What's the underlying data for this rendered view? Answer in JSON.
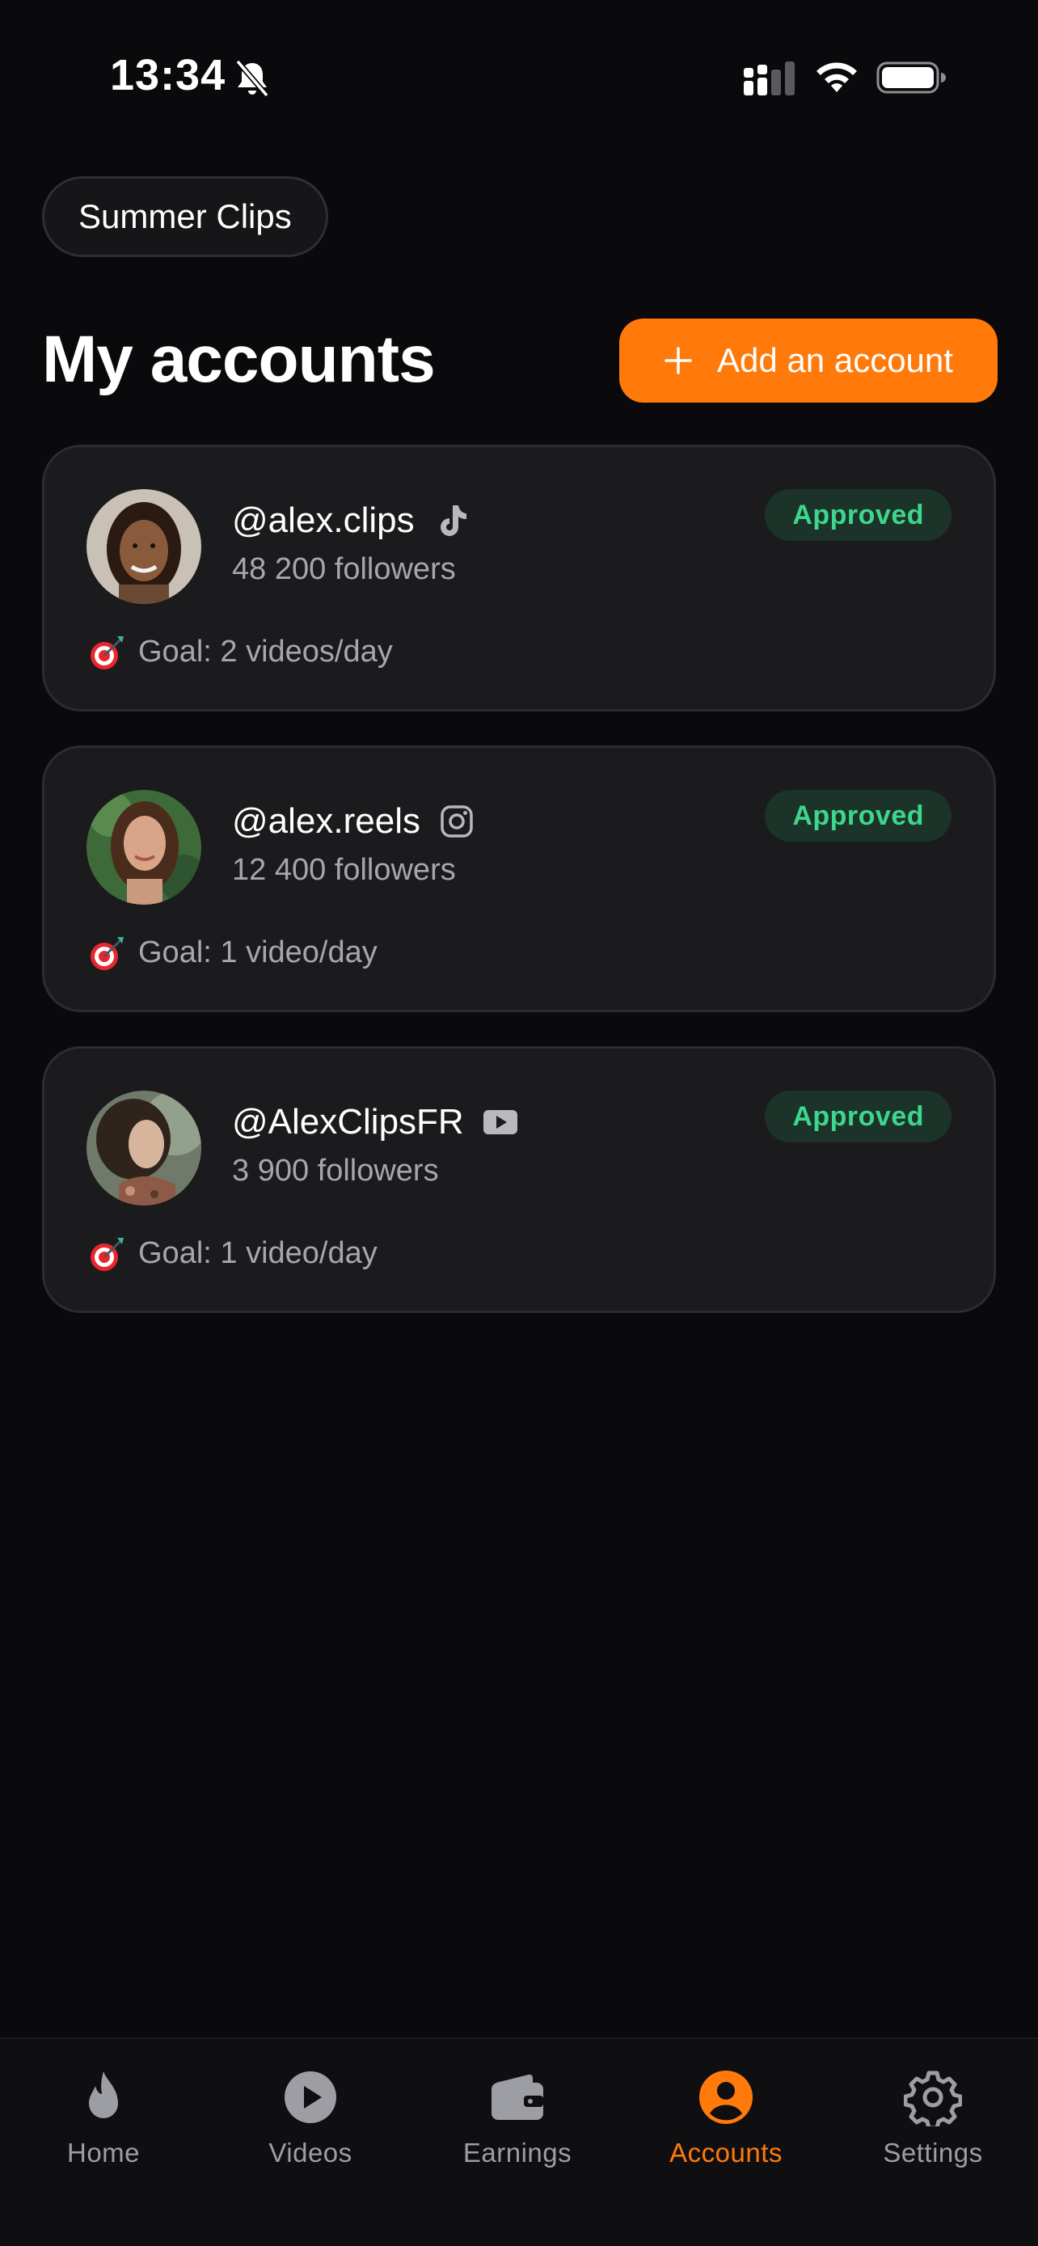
{
  "status_bar": {
    "time": "13:34",
    "icons": [
      "bell-slash-icon",
      "cellular-signal-icon",
      "wifi-icon",
      "battery-icon"
    ]
  },
  "campaign": {
    "label": "Summer Clips"
  },
  "header": {
    "title": "My accounts",
    "add_button_label": "Add an account",
    "add_button_icon": "plus-icon"
  },
  "colors": {
    "accent": "#ff7a0a",
    "approved_text": "#3dd68c",
    "approved_bg": "#1b3328",
    "background": "#0a0a0c",
    "card": "#1b1b1e"
  },
  "accounts": [
    {
      "handle": "@alex.clips",
      "platform": "tiktok-icon",
      "followers": "48 200 followers",
      "status": "Approved",
      "goal": "Goal: 2 videos/day",
      "goal_icon": "target-icon"
    },
    {
      "handle": "@alex.reels",
      "platform": "instagram-icon",
      "followers": "12 400 followers",
      "status": "Approved",
      "goal": "Goal: 1 video/day",
      "goal_icon": "target-icon"
    },
    {
      "handle": "@AlexClipsFR",
      "platform": "youtube-icon",
      "followers": "3 900 followers",
      "status": "Approved",
      "goal": "Goal: 1 video/day",
      "goal_icon": "target-icon"
    }
  ],
  "tab_bar": {
    "active": "Accounts",
    "tabs": [
      {
        "label": "Home",
        "icon": "flame-icon"
      },
      {
        "label": "Videos",
        "icon": "play-circle-icon"
      },
      {
        "label": "Earnings",
        "icon": "wallet-icon"
      },
      {
        "label": "Accounts",
        "icon": "user-circle-icon"
      },
      {
        "label": "Settings",
        "icon": "gear-icon"
      }
    ]
  }
}
